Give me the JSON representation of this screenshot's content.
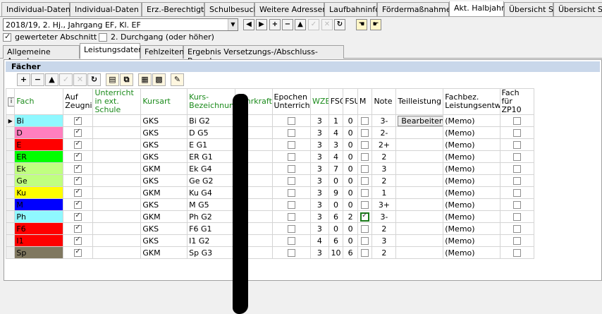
{
  "top_tabs": [
    {
      "label": "Individual-Daten I",
      "active": false
    },
    {
      "label": "Individual-Daten II",
      "active": false
    },
    {
      "label": "Erz.-Berechtigte",
      "active": false
    },
    {
      "label": "Schulbesuch",
      "active": false
    },
    {
      "label": "Weitere Adressen",
      "active": false
    },
    {
      "label": "Laufbahninfo",
      "active": false
    },
    {
      "label": "Fördermaßnahmen",
      "active": false
    },
    {
      "label": "Akt. Halbjahr",
      "active": true
    },
    {
      "label": "Übersicht S I",
      "active": false
    },
    {
      "label": "Übersicht S II",
      "active": false
    }
  ],
  "selector": {
    "value": "2018/19, 2. Hj., Jahrgang EF, Kl. EF"
  },
  "options": {
    "gewerteter": {
      "label": "gewerteter Abschnitt",
      "checked": true
    },
    "durchgang": {
      "label": "2. Durchgang (oder höher)",
      "checked": false
    }
  },
  "sub_tabs": [
    {
      "label": "Allgemeine Angaben",
      "active": false
    },
    {
      "label": "Leistungsdaten",
      "active": true
    },
    {
      "label": "Fehlzeiten",
      "active": false
    },
    {
      "label": "Ergebnis Versetzungs-/Abschluss-Berechnung",
      "active": false
    }
  ],
  "panel": {
    "title": "Fächer"
  },
  "columns": {
    "fach": "Fach",
    "auf_zeugnis": "Auf Zeugnis",
    "ext_schule": "Unterricht in ext. Schule",
    "kursart": "Kursart",
    "kurs_bez": "Kurs-Bezeichnung",
    "lehrkraft": "Lehrkraft",
    "epochen": "Epochen Unterricht",
    "wze": "WZE",
    "fsg": "FSG",
    "fsu": "FSU",
    "m": "M",
    "note": "Note",
    "teilleistung": "Teilleistung",
    "fachbez": "Fachbez. Leistungsentw.",
    "zp10": "Fach für ZP10"
  },
  "edit_button": "Bearbeiten",
  "memo": "(Memo)",
  "rows": [
    {
      "fach": "Bi",
      "color": "#8ff8ff",
      "kursart": "GKS",
      "kurs": "Bi G2",
      "wze": "3",
      "fsg": "1",
      "fsu": "0",
      "m": false,
      "note": "3-",
      "edit": true
    },
    {
      "fach": "D",
      "color": "#ff7fbf",
      "kursart": "GKS",
      "kurs": "D  G5",
      "wze": "3",
      "fsg": "4",
      "fsu": "0",
      "m": false,
      "note": "2-",
      "edit": false
    },
    {
      "fach": "E",
      "color": "#ff0000",
      "kursart": "GKS",
      "kurs": "E  G1",
      "wze": "3",
      "fsg": "3",
      "fsu": "0",
      "m": false,
      "note": "2+",
      "edit": false
    },
    {
      "fach": "ER",
      "color": "#00ff00",
      "kursart": "GKS",
      "kurs": "ER G1",
      "wze": "3",
      "fsg": "4",
      "fsu": "0",
      "m": false,
      "note": "2",
      "edit": false
    },
    {
      "fach": "Ek",
      "color": "#c0ff80",
      "kursart": "GKM",
      "kurs": "Ek G4",
      "wze": "3",
      "fsg": "7",
      "fsu": "0",
      "m": false,
      "note": "3",
      "edit": false
    },
    {
      "fach": "Ge",
      "color": "#c0ff80",
      "kursart": "GKS",
      "kurs": "Ge G2",
      "wze": "3",
      "fsg": "0",
      "fsu": "0",
      "m": false,
      "note": "2",
      "edit": false
    },
    {
      "fach": "Ku",
      "color": "#ffff00",
      "kursart": "GKM",
      "kurs": "Ku G4",
      "wze": "3",
      "fsg": "9",
      "fsu": "0",
      "m": false,
      "note": "1",
      "edit": false
    },
    {
      "fach": "M",
      "color": "#0000ff",
      "kursart": "GKS",
      "kurs": "M  G5",
      "wze": "3",
      "fsg": "0",
      "fsu": "0",
      "m": false,
      "note": "3+",
      "edit": false
    },
    {
      "fach": "Ph",
      "color": "#8ff8ff",
      "kursart": "GKM",
      "kurs": "Ph G2",
      "wze": "3",
      "fsg": "6",
      "fsu": "2",
      "m": true,
      "note": "3-",
      "edit": false
    },
    {
      "fach": "F6",
      "color": "#ff0000",
      "kursart": "GKS",
      "kurs": "F6 G1",
      "wze": "3",
      "fsg": "0",
      "fsu": "0",
      "m": false,
      "note": "2",
      "edit": false
    },
    {
      "fach": "I1",
      "color": "#ff0000",
      "kursart": "GKS",
      "kurs": "I1 G2",
      "wze": "4",
      "fsg": "6",
      "fsu": "0",
      "m": false,
      "note": "3",
      "edit": false
    },
    {
      "fach": "Sp",
      "color": "#807860",
      "kursart": "GKM",
      "kurs": "Sp G3",
      "wze": "3",
      "fsg": "10",
      "fsu": "6",
      "m": false,
      "note": "2",
      "edit": false
    }
  ]
}
